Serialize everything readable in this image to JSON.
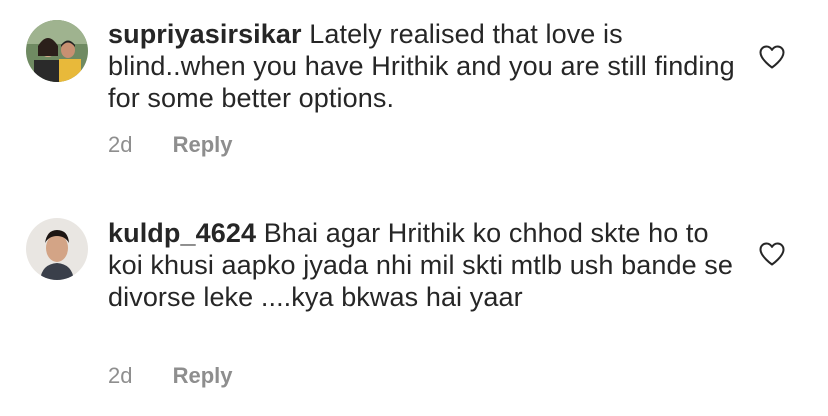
{
  "comments": [
    {
      "username": "supriyasirsikar",
      "text": "Lately realised that love is blind..when you have Hrithik and you are still finding for some better options.",
      "time": "2d",
      "reply_label": "Reply"
    },
    {
      "username": "kuldp_4624",
      "text": "Bhai agar Hrithik ko chhod skte ho to koi khusi aapko jyada nhi mil skti mtlb ush bande se divorse leke ....kya bkwas hai yaar",
      "time": "2d",
      "reply_label": "Reply"
    }
  ],
  "icons": {
    "like": "heart-icon",
    "avatar": "avatar"
  },
  "colors": {
    "text": "#262626",
    "meta": "#8e8e8e",
    "background": "#ffffff"
  }
}
